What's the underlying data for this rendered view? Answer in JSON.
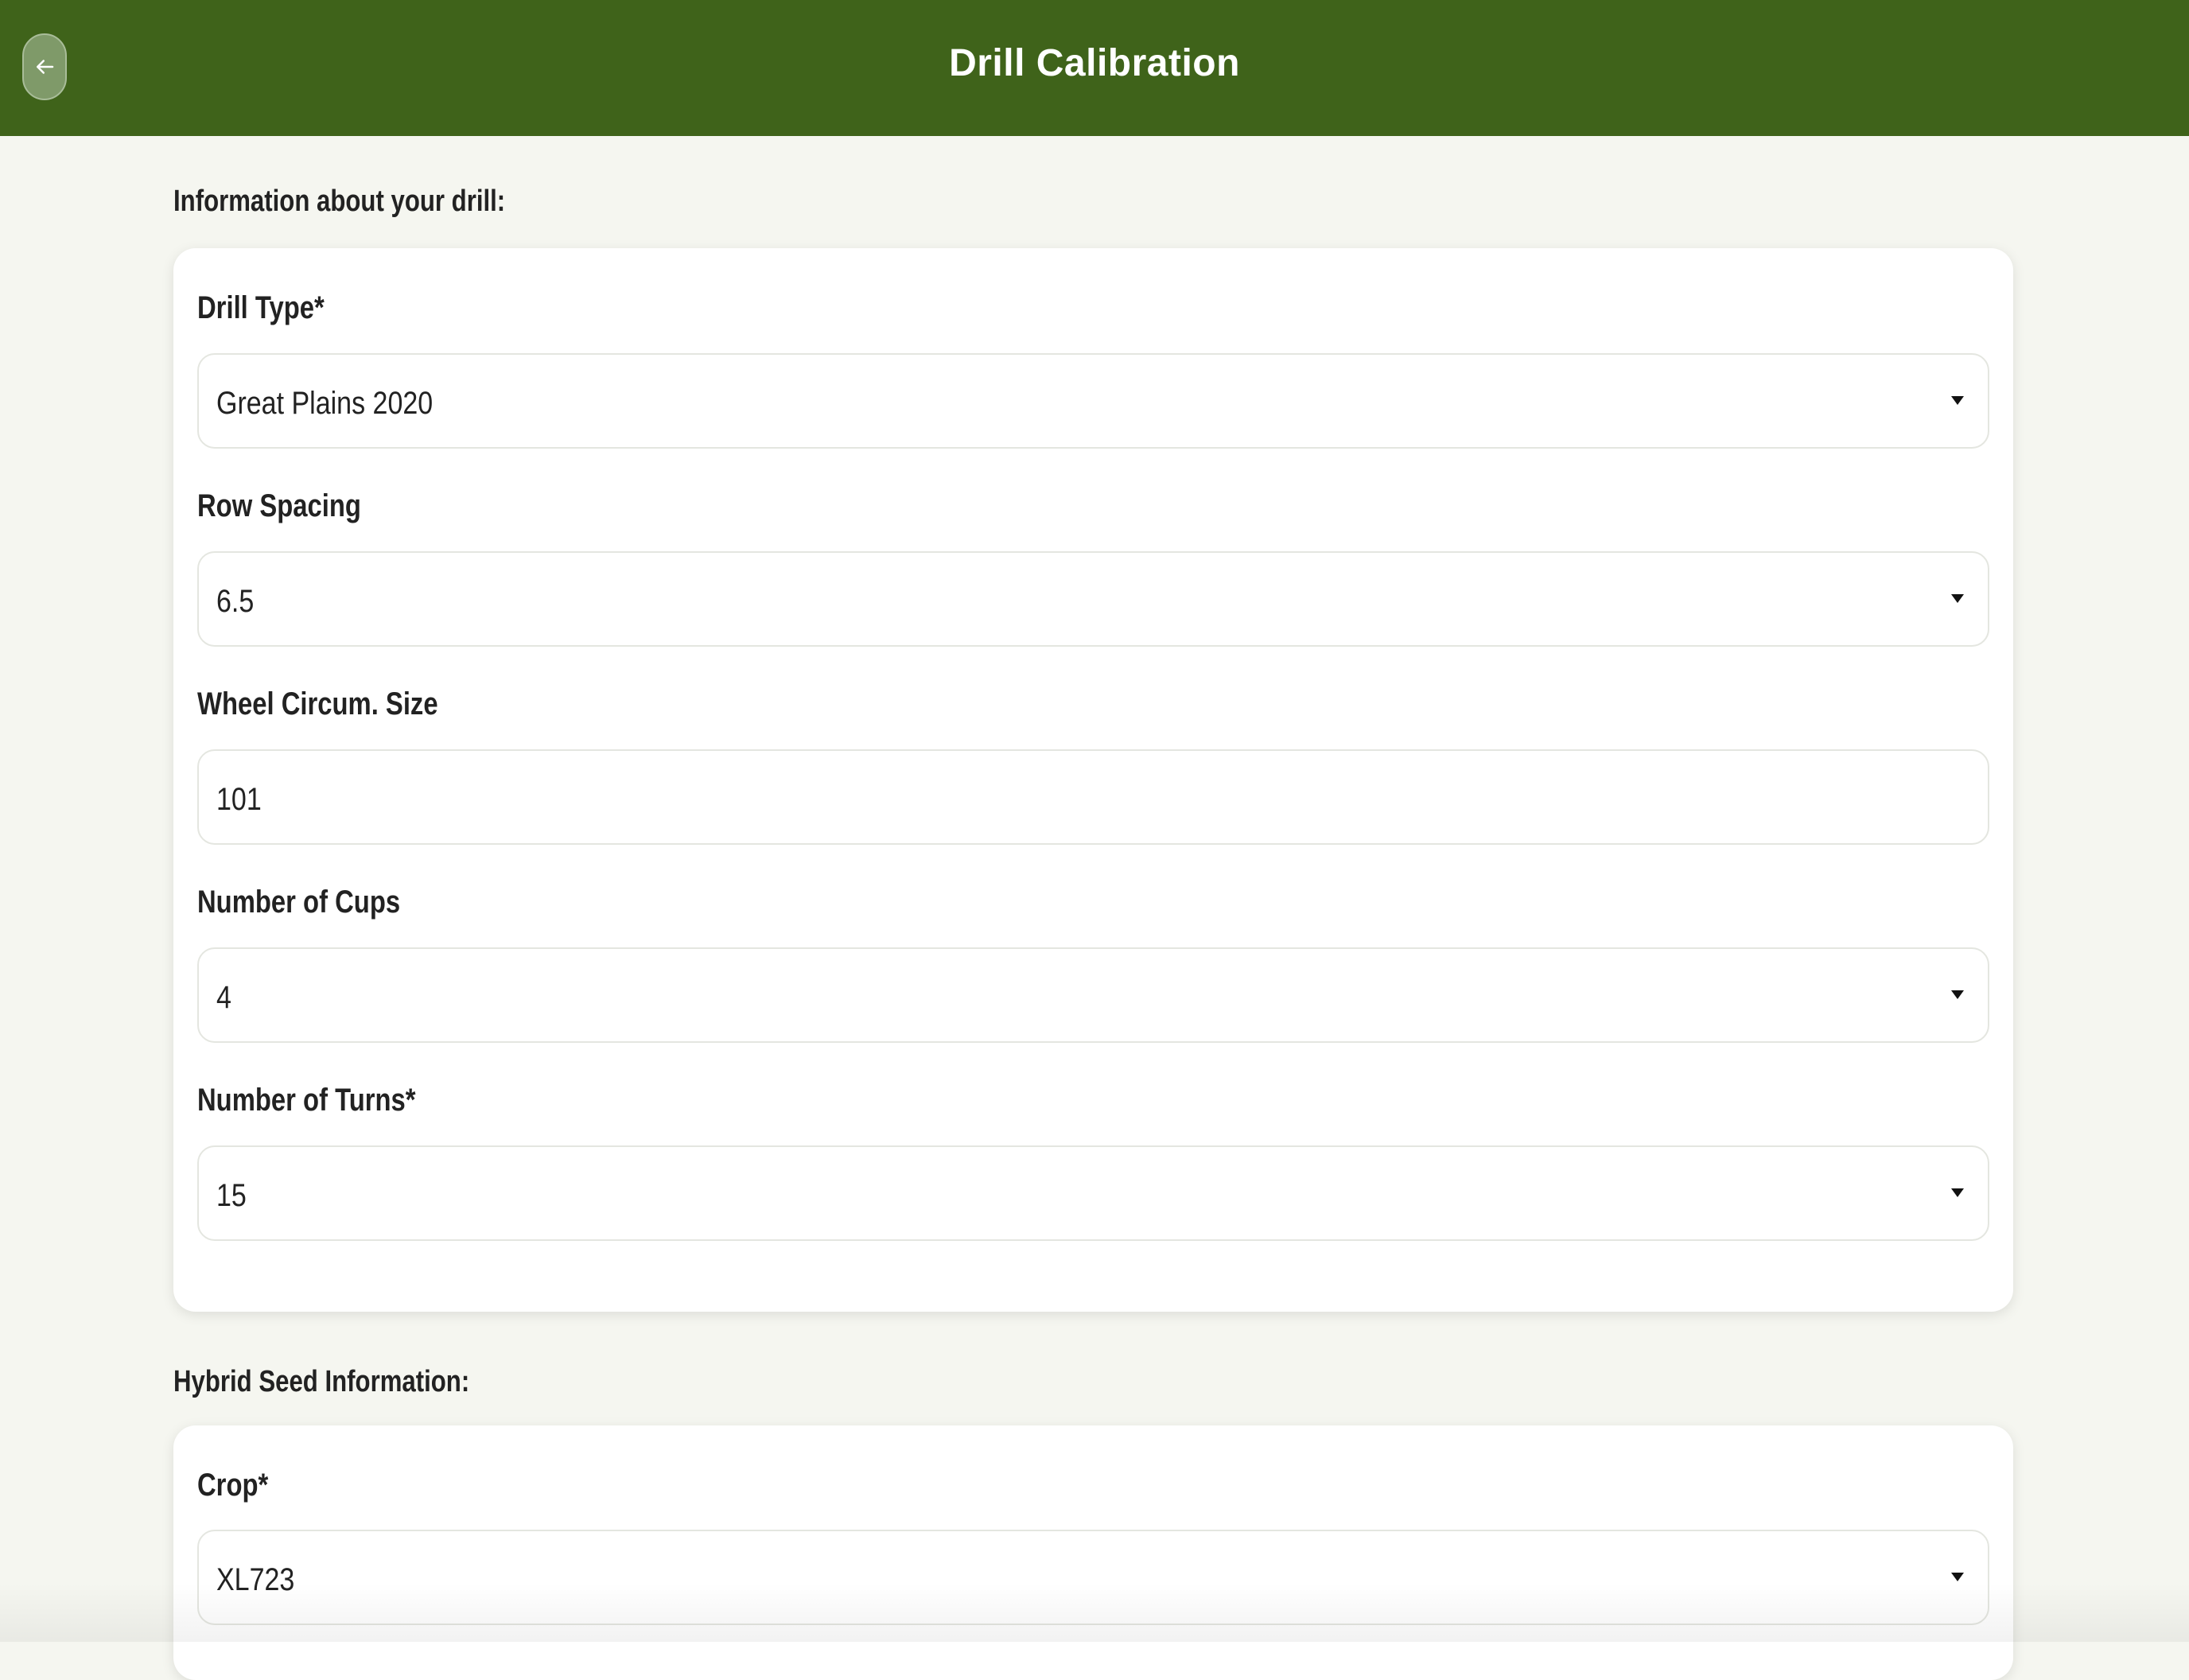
{
  "header": {
    "title": "Drill Calibration",
    "back_icon": "arrow-left-icon",
    "background_color": "#3f631a"
  },
  "drill_section": {
    "heading": "Information about your drill:",
    "fields": [
      {
        "label": "Drill Type*",
        "value": "Great Plains 2020",
        "type": "select"
      },
      {
        "label": "Row Spacing",
        "value": "6.5",
        "type": "select"
      },
      {
        "label": "Wheel Circum. Size",
        "value": "101",
        "type": "input"
      },
      {
        "label": "Number of Cups",
        "value": "4",
        "type": "select"
      },
      {
        "label": "Number of Turns*",
        "value": "15",
        "type": "select"
      }
    ]
  },
  "seed_section": {
    "heading": "Hybrid Seed Information:",
    "fields": [
      {
        "label": "Crop*",
        "value": "XL723",
        "type": "select"
      }
    ]
  },
  "dropdown_icon": "caret-down-icon"
}
